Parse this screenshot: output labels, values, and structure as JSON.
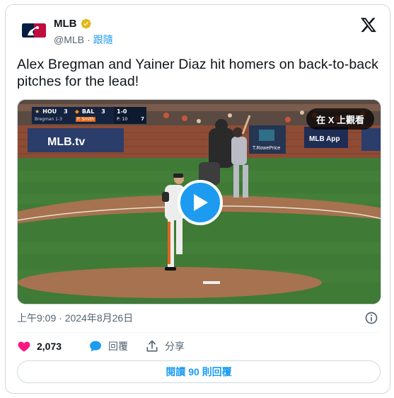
{
  "author": {
    "display_name": "MLB",
    "handle": "@MLB",
    "separator": "·",
    "follow_label": "跟隨",
    "avatar_icon": "mlb-logo-icon",
    "verified_icon": "verified-badge-icon"
  },
  "platform_icon": "x-logo-icon",
  "tweet": {
    "text": "Alex Bregman and Yainer Diaz hit homers on back-to-back pitches for the lead!"
  },
  "video": {
    "view_on_x_label": "在 X 上觀看",
    "play_icon": "play-icon",
    "score_bug": {
      "away_team": "HOU",
      "away_score": "3",
      "home_team": "BAL",
      "home_score": "3",
      "count": "1-0",
      "inning": "7",
      "batter": "Bregman 1-3",
      "pitcher": "P. Smith",
      "pitch_count": "P: 10"
    },
    "wall_ad_1": "MLB.tv",
    "wall_ad_2": "T.RowePrice",
    "wall_ad_3": "MLB App"
  },
  "meta": {
    "timestamp": "上午9:09 · 2024年8月26日",
    "info_icon": "info-icon"
  },
  "actions": {
    "like_count": "2,073",
    "reply_label": "回覆",
    "share_label": "分享"
  },
  "read_replies_label": "閱讀 90 則回覆",
  "colors": {
    "accent": "#1d9bf0",
    "like": "#f91880",
    "text_secondary": "#536471",
    "border": "#cfd9de"
  }
}
